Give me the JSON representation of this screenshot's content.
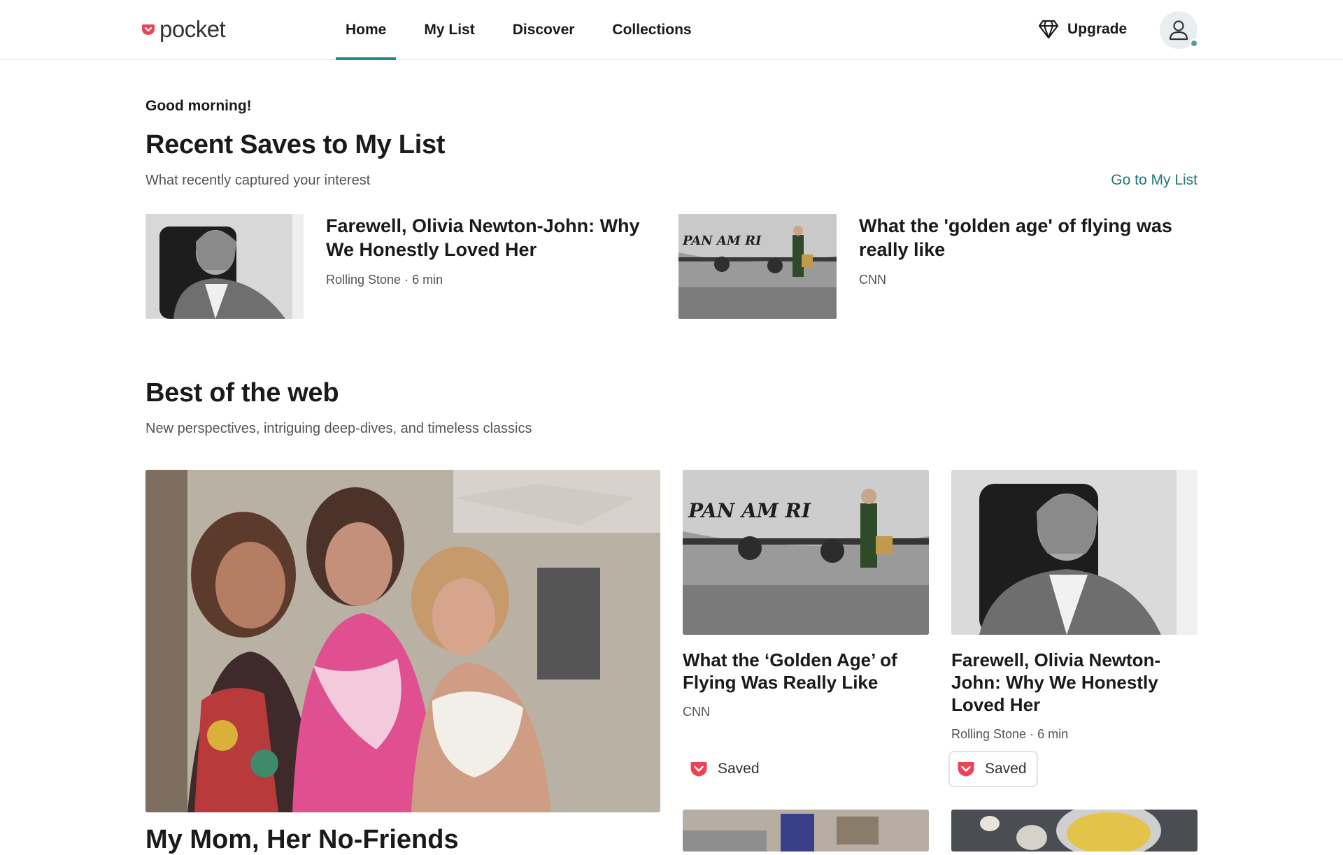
{
  "brand": {
    "logo_text": "pocket",
    "accent": "#1f8a83",
    "pocket_red": "#ef4056"
  },
  "nav": {
    "tabs": [
      {
        "label": "Home",
        "active": true
      },
      {
        "label": "My List",
        "active": false
      },
      {
        "label": "Discover",
        "active": false
      },
      {
        "label": "Collections",
        "active": false
      }
    ]
  },
  "header": {
    "upgrade_label": "Upgrade",
    "upgrade_icon": "diamond-icon",
    "avatar_icon": "user-icon"
  },
  "recent": {
    "greeting": "Good morning!",
    "title": "Recent Saves to My List",
    "subtitle": "What recently captured your interest",
    "link": "Go to My List",
    "items": [
      {
        "title": "Farewell, Olivia Newton-John: Why We Honestly Loved Her",
        "meta": "Rolling Stone · 6 min"
      },
      {
        "title": "What the 'golden age' of flying was really like",
        "meta": "CNN"
      }
    ]
  },
  "best": {
    "title": "Best of the web",
    "subtitle": "New perspectives, intriguing deep-dives, and timeless classics",
    "hero_title": "My Mom, Her No-Friends",
    "cards": [
      {
        "title": "What the ‘Golden Age’ of Flying Was Really Like",
        "meta": "CNN",
        "saved_label": "Saved"
      },
      {
        "title": "Farewell, Olivia Newton-John: Why We Honestly Loved Her",
        "meta": "Rolling Stone · 6 min",
        "saved_label": "Saved"
      }
    ]
  }
}
